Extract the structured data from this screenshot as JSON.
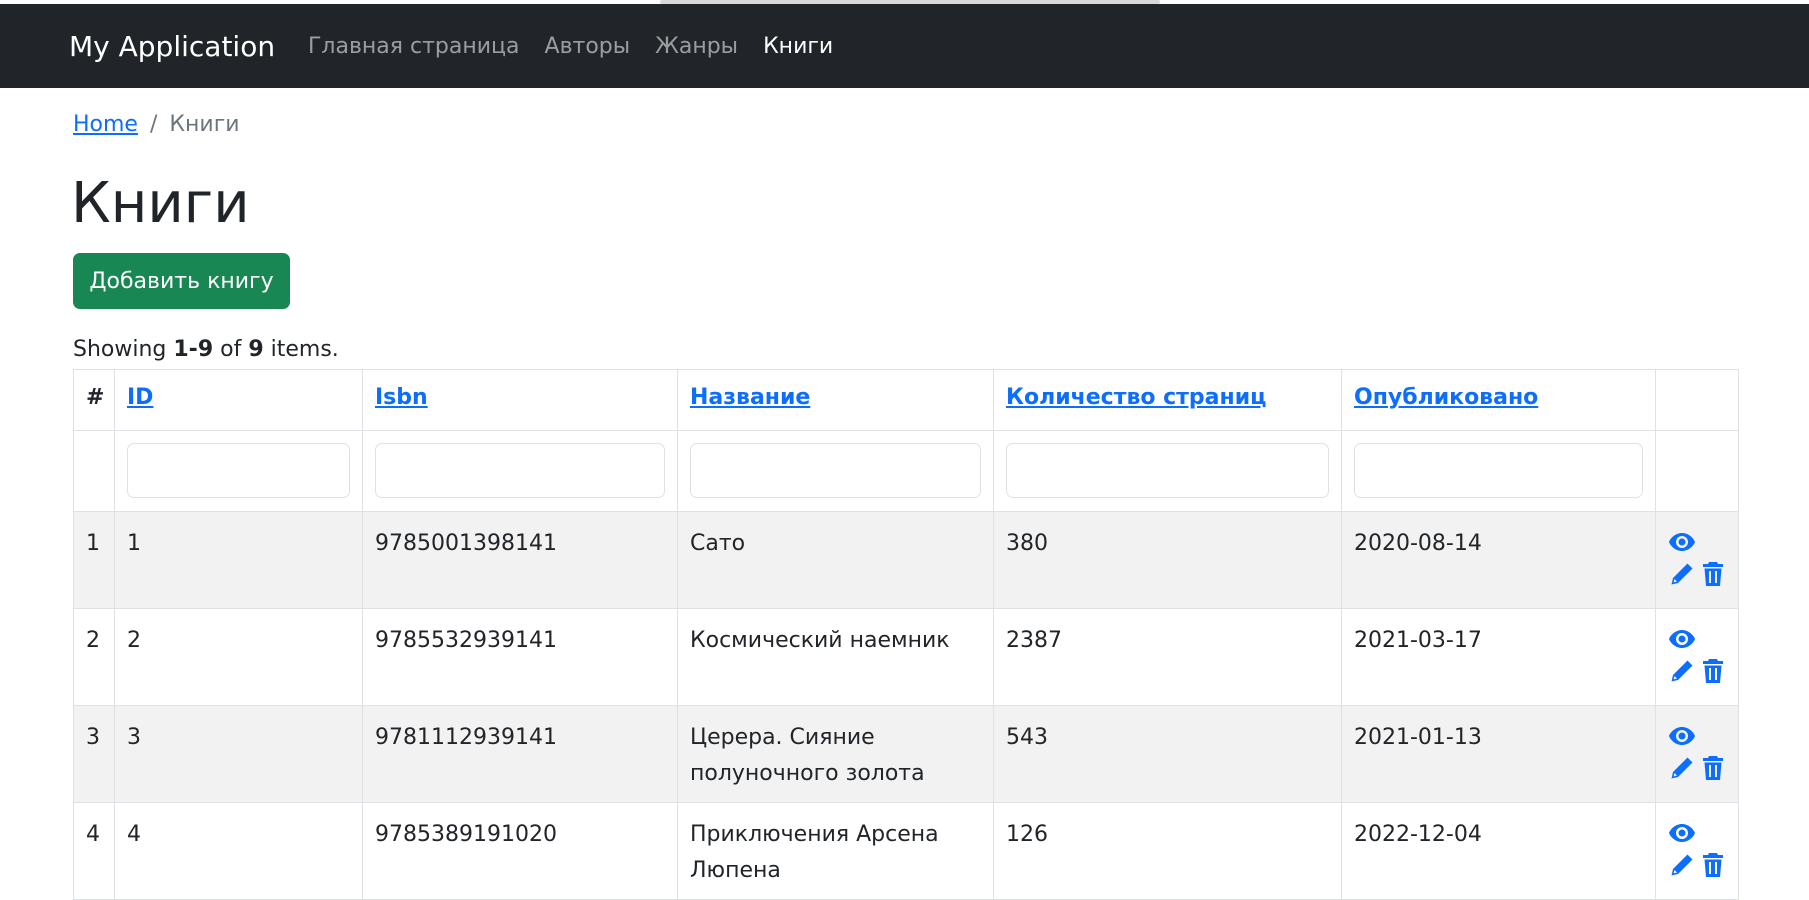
{
  "navbar": {
    "brand": "My Application",
    "links": [
      {
        "label": "Главная страница",
        "active": false
      },
      {
        "label": "Авторы",
        "active": false
      },
      {
        "label": "Жанры",
        "active": false
      },
      {
        "label": "Книги",
        "active": true
      }
    ]
  },
  "breadcrumb": {
    "home": "Home",
    "separator": "/",
    "current": "Книги"
  },
  "page": {
    "title": "Книги",
    "add_button": "Добавить книгу",
    "summary": {
      "prefix": "Showing ",
      "range": "1-9",
      "middle": " of ",
      "total": "9",
      "suffix": " items."
    }
  },
  "table": {
    "headers": {
      "index": "#",
      "id": "ID",
      "isbn": "Isbn",
      "title": "Название",
      "pages": "Количество страниц",
      "published": "Опубликовано"
    },
    "rows": [
      {
        "index": "1",
        "id": "1",
        "isbn": "9785001398141",
        "title": "Сато",
        "pages": "380",
        "published": "2020-08-14"
      },
      {
        "index": "2",
        "id": "2",
        "isbn": "9785532939141",
        "title": "Космический наемник",
        "pages": "2387",
        "published": "2021-03-17"
      },
      {
        "index": "3",
        "id": "3",
        "isbn": "9781112939141",
        "title": "Церера. Сияние полуночного золота",
        "pages": "543",
        "published": "2021-01-13"
      },
      {
        "index": "4",
        "id": "4",
        "isbn": "9785389191020",
        "title": "Приключения Арсена Люпена",
        "pages": "126",
        "published": "2022-12-04"
      }
    ]
  },
  "icons": {
    "view": "eye-icon",
    "edit": "pencil-icon",
    "delete": "trash-icon"
  },
  "colors": {
    "navbar_bg": "#212529",
    "link": "#0d6efd",
    "success_button": "#198754",
    "striped_row": "#f2f2f2"
  }
}
